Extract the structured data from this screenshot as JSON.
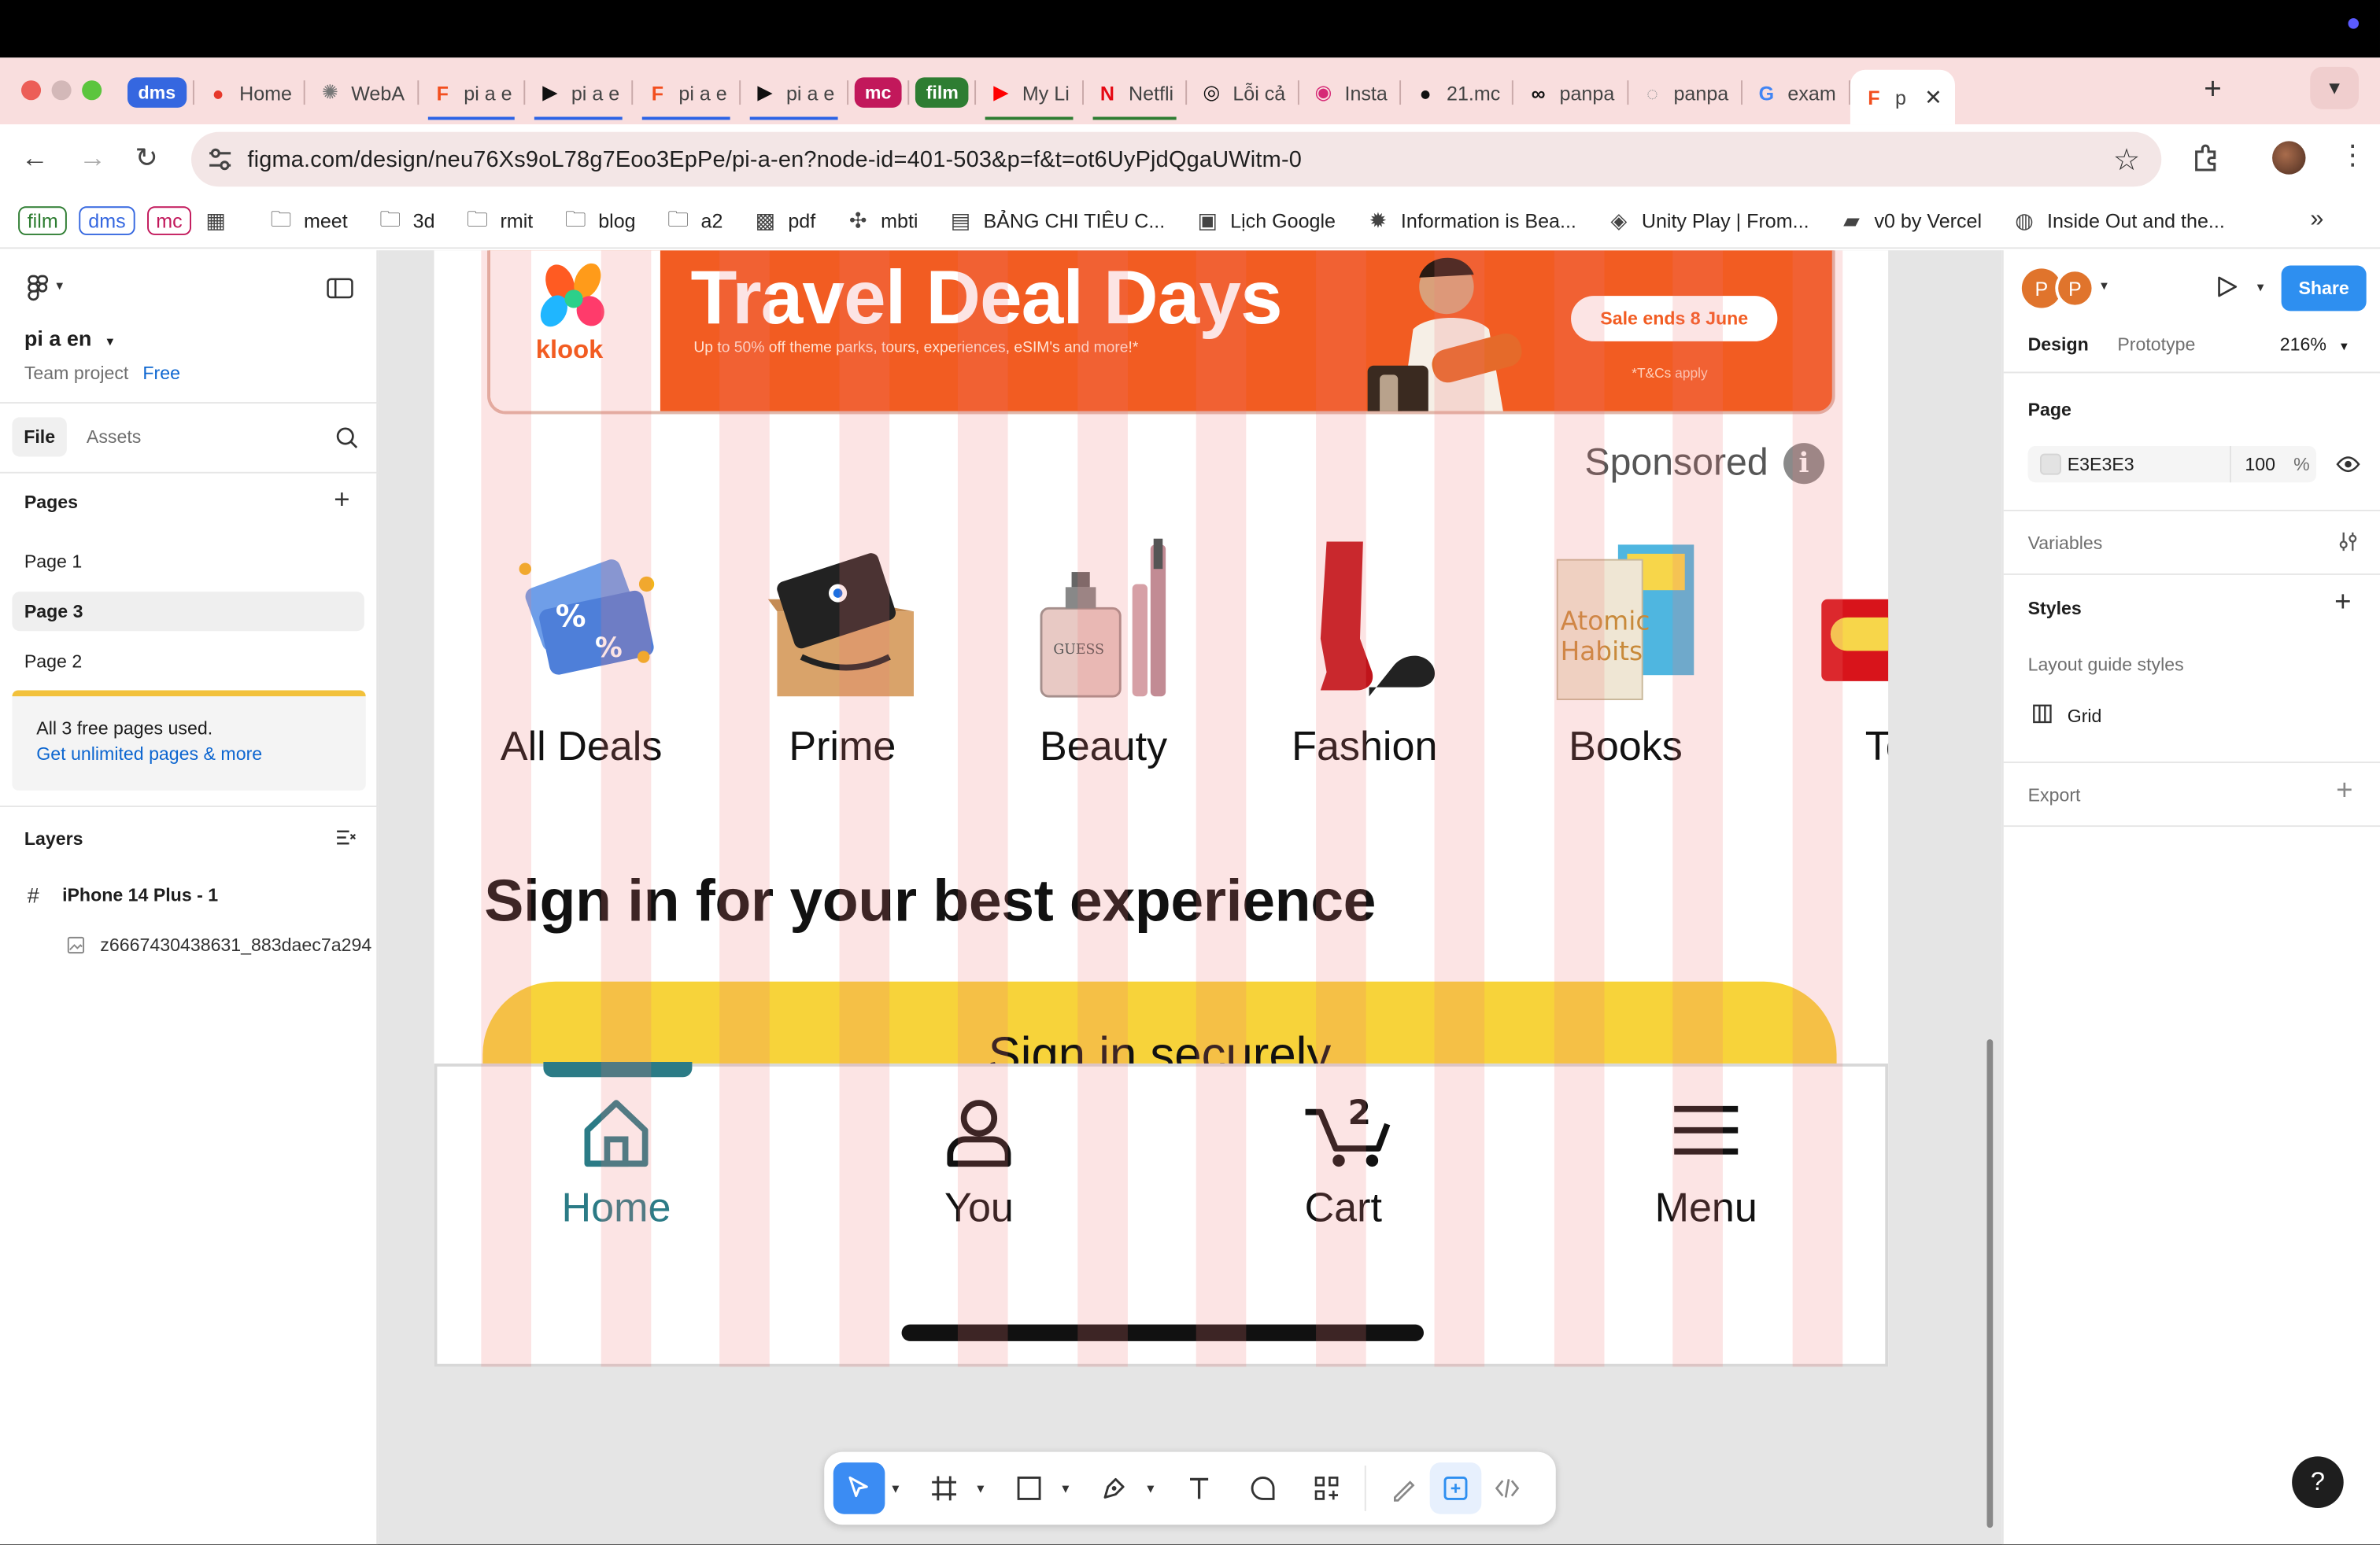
{
  "browser": {
    "tabs": [
      {
        "type": "tag",
        "label": "dms",
        "color": "#3567e0"
      },
      {
        "label": "Home",
        "favicon": "red-blob-icon",
        "color": "#e6382b",
        "underline": ""
      },
      {
        "label": "WebA",
        "favicon": "gear-icon",
        "color": "#777777",
        "underline": ""
      },
      {
        "label": "pi a e",
        "favicon": "figma-icon",
        "color": "#f24e1e",
        "underline": "#2b63e6"
      },
      {
        "label": "pi a e",
        "favicon": "play-icon",
        "color": "#111111",
        "underline": "#2b63e6"
      },
      {
        "label": "pi a e",
        "favicon": "figma-icon",
        "color": "#f24e1e",
        "underline": "#2b63e6"
      },
      {
        "label": "pi a e",
        "favicon": "play-icon",
        "color": "#111111",
        "underline": "#2b63e6"
      },
      {
        "type": "tag",
        "label": "mc",
        "color": "#c2185b"
      },
      {
        "type": "tag",
        "label": "film",
        "color": "#2e7d32"
      },
      {
        "label": "My Li",
        "favicon": "youtube-icon",
        "color": "#ff0000",
        "underline": "#2e7d32"
      },
      {
        "label": "Netfli",
        "favicon": "netflix-icon",
        "color": "#e50914",
        "underline": "#2e7d32"
      },
      {
        "label": "Lỗi cả",
        "favicon": "openai-icon",
        "color": "#111111",
        "underline": ""
      },
      {
        "label": "Insta",
        "favicon": "instagram-icon",
        "color": "#d62976",
        "underline": ""
      },
      {
        "label": "21.mc",
        "favicon": "github-icon",
        "color": "#111111",
        "underline": ""
      },
      {
        "label": "panpa",
        "favicon": "loop-icon",
        "color": "#111111",
        "underline": ""
      },
      {
        "label": "panpa",
        "favicon": "spinner-icon",
        "color": "#999999",
        "underline": ""
      },
      {
        "label": "exam",
        "favicon": "google-icon",
        "color": "#4285f4",
        "underline": ""
      },
      {
        "label": "p",
        "favicon": "figma-icon",
        "color": "#f24e1e",
        "underline": "",
        "active": true
      }
    ],
    "url": "figma.com/design/neu76Xs9oL78g7Eoo3EpPe/pi-a-en?node-id=401-503&p=f&t=ot6UyPjdQgaUWitm-0",
    "bookmarks": [
      {
        "type": "tag",
        "label": "film",
        "color": "#2e7d32"
      },
      {
        "type": "tag",
        "label": "dms",
        "color": "#3567e0"
      },
      {
        "type": "tag",
        "label": "mc",
        "color": "#c2185b"
      },
      {
        "label": "",
        "icon": "apps-grid-icon"
      },
      {
        "label": "meet",
        "icon": "folder-icon"
      },
      {
        "label": "3d",
        "icon": "folder-icon"
      },
      {
        "label": "rmit",
        "icon": "folder-icon"
      },
      {
        "label": "blog",
        "icon": "folder-icon"
      },
      {
        "label": "a2",
        "icon": "folder-icon"
      },
      {
        "label": "pdf",
        "icon": "colorful-grid-icon"
      },
      {
        "label": "mbti",
        "icon": "mbti-icon"
      },
      {
        "label": "BẢNG CHI TIÊU C...",
        "icon": "sheets-icon"
      },
      {
        "label": "Lịch Google",
        "icon": "calendar-icon"
      },
      {
        "label": "Information is Bea...",
        "icon": "info-beautiful-icon"
      },
      {
        "label": "Unity Play | From...",
        "icon": "unity-icon"
      },
      {
        "label": "v0 by Vercel",
        "icon": "v0-icon"
      },
      {
        "label": "Inside Out and the...",
        "icon": "globe-icon"
      }
    ]
  },
  "figma": {
    "file_name": "pi a en",
    "team": "Team project",
    "plan": "Free",
    "left_tabs": {
      "file": "File",
      "assets": "Assets"
    },
    "pages_title": "Pages",
    "pages": [
      "Page 1",
      "Page 3",
      "Page 2"
    ],
    "selected_page": "Page 3",
    "upgrade": {
      "line1": "All 3 free pages used.",
      "line2": "Get unlimited pages & more"
    },
    "layers_title": "Layers",
    "layers": [
      {
        "name": "iPhone 14 Plus - 1",
        "icon": "frame-hash-icon"
      },
      {
        "name": "z6667430438631_883daec7a294",
        "icon": "image-icon"
      }
    ],
    "right": {
      "avatars": [
        "P",
        "P"
      ],
      "share": "Share",
      "tabs": {
        "design": "Design",
        "prototype": "Prototype"
      },
      "zoom": "216%",
      "page_section": "Page",
      "page_color": "E3E3E3",
      "page_opacity": "100",
      "opacity_unit": "%",
      "variables": "Variables",
      "styles": "Styles",
      "layout_guide": "Layout guide styles",
      "grid": "Grid",
      "export": "Export"
    },
    "help": "?"
  },
  "canvas": {
    "banner": {
      "brand": "klook",
      "title": "Travel Deal Days",
      "subtitle": "Up to 50% off theme parks, tours, experiences, eSIM's and more!*",
      "pill": "Sale ends 8 June",
      "tc": "*T&Cs apply"
    },
    "sponsored": "Sponsored",
    "categories": [
      "All Deals",
      "Prime",
      "Beauty",
      "Fashion",
      "Books",
      "To"
    ],
    "signin_title": "Sign in for your best experience",
    "signin_button": "Sign in securely",
    "nav": [
      {
        "label": "Home",
        "icon": "home-icon",
        "active": true
      },
      {
        "label": "You",
        "icon": "person-icon"
      },
      {
        "label": "Cart",
        "icon": "cart-icon",
        "badge": "2"
      },
      {
        "label": "Menu",
        "icon": "hamburger-menu-icon"
      }
    ],
    "colors": {
      "active_nav": "#2b7b86",
      "signin_button": "#f7d33a",
      "banner": "#f25c22"
    }
  }
}
